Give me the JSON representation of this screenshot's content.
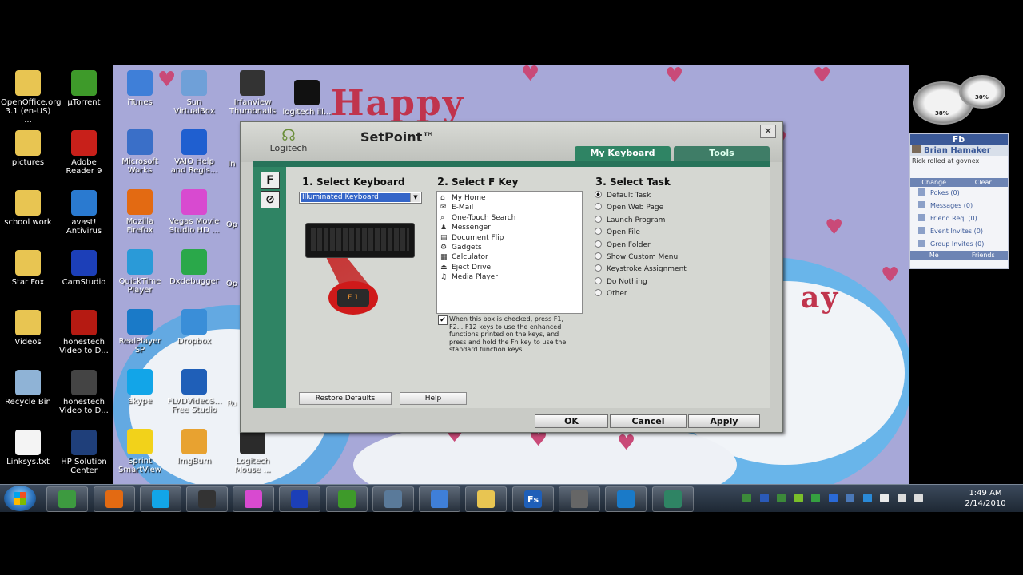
{
  "desktop": {
    "left_icons": [
      {
        "label": "OpenOffice.org 3.1 (en-US) ...",
        "icon": "folder-icon",
        "color": "#e8c552"
      },
      {
        "label": "µTorrent",
        "icon": "utorrent-icon",
        "color": "#3e9a2a"
      },
      {
        "label": "pictures",
        "icon": "folder-icon",
        "color": "#e8c552"
      },
      {
        "label": "Adobe Reader 9",
        "icon": "adobe-reader-icon",
        "color": "#c8201a"
      },
      {
        "label": "school work",
        "icon": "folder-icon",
        "color": "#e8c552"
      },
      {
        "label": "avast! Antivirus",
        "icon": "avast-icon",
        "color": "#2a7ad0"
      },
      {
        "label": "Star Fox",
        "icon": "folder-icon",
        "color": "#e8c552"
      },
      {
        "label": "CamStudio",
        "icon": "camstudio-icon",
        "color": "#1c3fb8"
      },
      {
        "label": "Videos",
        "icon": "folder-icon",
        "color": "#e8c552"
      },
      {
        "label": "honestech Video to D...",
        "icon": "pdf-icon",
        "color": "#b51a12"
      },
      {
        "label": "Recycle Bin",
        "icon": "recycle-bin-icon",
        "color": "#8fb3d6"
      },
      {
        "label": "honestech Video to D...",
        "icon": "video-to-dvd-icon",
        "color": "#444444"
      },
      {
        "label": "Linksys.txt",
        "icon": "text-file-icon",
        "color": "#f4f4f4"
      },
      {
        "label": "HP Solution Center",
        "icon": "hp-icon",
        "color": "#1f3f7a"
      }
    ],
    "wall_icons": [
      {
        "label": "iTunes",
        "icon": "itunes-icon",
        "color": "#3f7fd8"
      },
      {
        "label": "Sun VirtualBox",
        "icon": "virtualbox-icon",
        "color": "#6fa0d8"
      },
      {
        "label": "IrfanView Thumbnails",
        "icon": "irfanview-icon",
        "color": "#333333"
      },
      {
        "label": "logitech ill...",
        "icon": "keyboard-icon",
        "color": "#111111"
      },
      {
        "label": "Microsoft Works",
        "icon": "works-icon",
        "color": "#3a6fc8"
      },
      {
        "label": "VAIO Help and Regis...",
        "icon": "help-icon",
        "color": "#1f5fd0"
      },
      {
        "label": "Mozilla Firefox",
        "icon": "firefox-icon",
        "color": "#e36a12"
      },
      {
        "label": "Vegas Movie Studio HD ...",
        "icon": "vegas-icon",
        "color": "#d84ad0"
      },
      {
        "label": "QuickTime Player",
        "icon": "quicktime-icon",
        "color": "#2a9ad8"
      },
      {
        "label": "Dxdebugger",
        "icon": "dxdebugger-icon",
        "color": "#2aa84a"
      },
      {
        "label": "RealPlayer SP",
        "icon": "realplayer-icon",
        "color": "#1a7ac8"
      },
      {
        "label": "Dropbox",
        "icon": "dropbox-icon",
        "color": "#3a8ed8"
      },
      {
        "label": "Skype",
        "icon": "skype-icon",
        "color": "#12a5e8"
      },
      {
        "label": "FLVDVideoS... Free Studio",
        "icon": "free-studio-icon",
        "color": "#1f5fb8"
      },
      {
        "label": "Sprint SmartView",
        "icon": "sprint-icon",
        "color": "#f2d21a"
      },
      {
        "label": "ImgBurn",
        "icon": "imgburn-icon",
        "color": "#e8a230"
      },
      {
        "label": "Logitech Mouse ...",
        "icon": "mouse-icon",
        "color": "#2b2b2b"
      }
    ],
    "partial_labels": [
      "In",
      "Op",
      "Op",
      "Ru"
    ]
  },
  "wallpaper": {
    "text": "Happy",
    "text2": "ay"
  },
  "setpoint": {
    "logo_text": "Logitech",
    "title": "SetPoint™",
    "tabs": [
      "My Keyboard",
      "Tools"
    ],
    "side_buttons": [
      "F",
      "⊘"
    ],
    "select_keyboard": {
      "number": "1.",
      "heading": "Select Keyboard",
      "value": "Illuminated Keyboard"
    },
    "select_fkey": {
      "number": "2.",
      "heading": "Select F Key",
      "items": [
        {
          "label": "My Home",
          "icon": "home-icon",
          "glyph": "⌂"
        },
        {
          "label": "E-Mail",
          "icon": "email-icon",
          "glyph": "✉"
        },
        {
          "label": "One-Touch Search",
          "icon": "search-icon",
          "glyph": "⌕"
        },
        {
          "label": "Messenger",
          "icon": "messenger-icon",
          "glyph": "♟"
        },
        {
          "label": "Document Flip",
          "icon": "document-flip-icon",
          "glyph": "▤"
        },
        {
          "label": "Gadgets",
          "icon": "gadgets-icon",
          "glyph": "⚙"
        },
        {
          "label": "Calculator",
          "icon": "calculator-icon",
          "glyph": "▦"
        },
        {
          "label": "Eject Drive",
          "icon": "eject-icon",
          "glyph": "⏏"
        },
        {
          "label": "Media Player",
          "icon": "media-player-icon",
          "glyph": "♫"
        }
      ],
      "fn_checkbox_checked": true,
      "fn_text": "When this box is checked, press F1, F2... F12 keys to use the enhanced functions printed on the keys, and press and hold the Fn key to use the standard function keys."
    },
    "select_task": {
      "number": "3.",
      "heading": "Select Task",
      "selected": "Default Task",
      "options": [
        "Default Task",
        "Open Web Page",
        "Launch Program",
        "Open File",
        "Open Folder",
        "Show Custom Menu",
        "Keystroke Assignment",
        "Do Nothing",
        "Other"
      ]
    },
    "restore_label": "Restore Defaults",
    "help_label": "Help",
    "ok_label": "OK",
    "cancel_label": "Cancel",
    "apply_label": "Apply",
    "fn_key_label": "F 1"
  },
  "gauge": {
    "left_value": "38%",
    "right_value": "30%"
  },
  "facebook": {
    "title": "Fb",
    "user": "Brian Hamaker",
    "status": "Rick rolled at govnex",
    "bar1": [
      "Change",
      "Clear"
    ],
    "rows": [
      {
        "label": "Pokes (0)",
        "icon": "poke-icon"
      },
      {
        "label": "Messages (0)",
        "icon": "messages-icon"
      },
      {
        "label": "Friend Req. (0)",
        "icon": "friend-request-icon"
      },
      {
        "label": "Event Invites (0)",
        "icon": "event-icon"
      },
      {
        "label": "Group Invites (0)",
        "icon": "group-icon"
      }
    ],
    "bar2": [
      "Me",
      "Friends"
    ]
  },
  "taskbar": {
    "buttons": [
      {
        "icon": "network-computer-icon",
        "color": "#3d9a40"
      },
      {
        "icon": "firefox-icon",
        "color": "#e36a12"
      },
      {
        "icon": "skype-icon",
        "color": "#12a5e8"
      },
      {
        "icon": "video-capture-icon",
        "color": "#333333"
      },
      {
        "icon": "vegas-icon",
        "color": "#d84ad0"
      },
      {
        "icon": "camstudio-icon",
        "color": "#1c3fb8"
      },
      {
        "icon": "utorrent-icon",
        "color": "#3e9a2a"
      },
      {
        "icon": "spreadsheet-icon",
        "color": "#5a7a9a"
      },
      {
        "icon": "itunes-icon",
        "color": "#3f7fd8"
      },
      {
        "icon": "folder-icon",
        "color": "#e8c552"
      },
      {
        "icon": "free-studio-icon",
        "color": "#1f5fb8",
        "text": "Fs"
      },
      {
        "icon": "tool-icon",
        "color": "#666666"
      },
      {
        "icon": "realplayer-icon",
        "color": "#1a7ac8"
      },
      {
        "icon": "setpoint-icon",
        "color": "#2f8464"
      }
    ],
    "time": "1:49 AM",
    "date": "2/14/2010",
    "tray_icons": [
      "logitech-tray-icon",
      "display-icon",
      "network-icon",
      "green-leaf-icon",
      "sync-icon",
      "bluetooth-icon",
      "usb-icon",
      "messenger-tray-icon",
      "flag-icon",
      "signal-icon",
      "volume-icon"
    ]
  }
}
